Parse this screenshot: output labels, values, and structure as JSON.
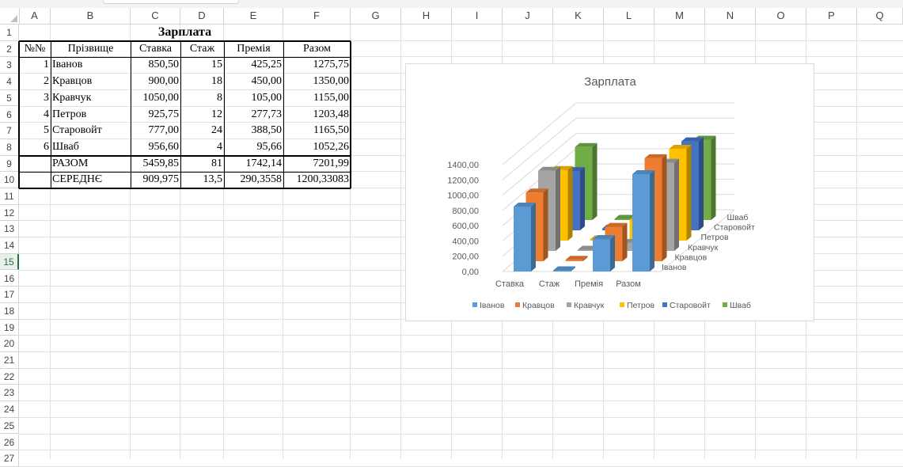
{
  "sheet": {
    "columns": [
      "A",
      "B",
      "C",
      "D",
      "E",
      "F",
      "G",
      "H",
      "I",
      "J",
      "K",
      "L",
      "M",
      "N",
      "O",
      "P",
      "Q"
    ],
    "rows": [
      "1",
      "2",
      "3",
      "4",
      "5",
      "6",
      "7",
      "8",
      "9",
      "10",
      "11",
      "12",
      "13",
      "14",
      "15",
      "16",
      "17",
      "18",
      "19",
      "20",
      "21",
      "22",
      "23",
      "24",
      "25",
      "26",
      "27"
    ],
    "active_row": "15"
  },
  "table": {
    "title": "Зарплата",
    "headers": [
      "№№",
      "Прізвище",
      "Ставка",
      "Стаж",
      "Премія",
      "Разом"
    ],
    "rows": [
      [
        "1",
        "Іванов",
        "850,50",
        "15",
        "425,25",
        "1275,75"
      ],
      [
        "2",
        "Кравцов",
        "900,00",
        "18",
        "450,00",
        "1350,00"
      ],
      [
        "3",
        "Кравчук",
        "1050,00",
        "8",
        "105,00",
        "1155,00"
      ],
      [
        "4",
        "Петров",
        "925,75",
        "12",
        "277,73",
        "1203,48"
      ],
      [
        "5",
        "Старовойт",
        "777,00",
        "24",
        "388,50",
        "1165,50"
      ],
      [
        "6",
        "Шваб",
        "956,60",
        "4",
        "95,66",
        "1052,26"
      ]
    ],
    "total": {
      "label": "РАЗОМ",
      "stavka": "5459,85",
      "stazh": "81",
      "premiya": "1742,14",
      "razom": "7201,99"
    },
    "average": {
      "label": "СЕРЕДНЄ",
      "stavka": "909,975",
      "stazh": "13,5",
      "premiya": "290,3558",
      "razom": "1200,33083"
    }
  },
  "chart_data": {
    "type": "bar",
    "variant": "3d-column",
    "title": "Зарплата",
    "categories": [
      "Ставка",
      "Стаж",
      "Премія",
      "Разом"
    ],
    "series": [
      {
        "name": "Іванов",
        "values": [
          850.5,
          15,
          425.25,
          1275.75
        ],
        "color": "#5b9bd5"
      },
      {
        "name": "Кравцов",
        "values": [
          900.0,
          18,
          450.0,
          1350.0
        ],
        "color": "#ed7d31"
      },
      {
        "name": "Кравчук",
        "values": [
          1050.0,
          8,
          105.0,
          1155.0
        ],
        "color": "#a5a5a5"
      },
      {
        "name": "Петров",
        "values": [
          925.75,
          12,
          277.73,
          1203.48
        ],
        "color": "#ffc000"
      },
      {
        "name": "Старовойт",
        "values": [
          777.0,
          24,
          388.5,
          1165.5
        ],
        "color": "#4472c4"
      },
      {
        "name": "Шваб",
        "values": [
          956.6,
          4,
          95.66,
          1052.26
        ],
        "color": "#70ad47"
      }
    ],
    "yticks": [
      "0,00",
      "200,00",
      "400,00",
      "600,00",
      "800,00",
      "1000,00",
      "1200,00",
      "1400,00"
    ],
    "ylim": [
      0,
      1400
    ],
    "legend_position": "bottom",
    "grid": true
  }
}
